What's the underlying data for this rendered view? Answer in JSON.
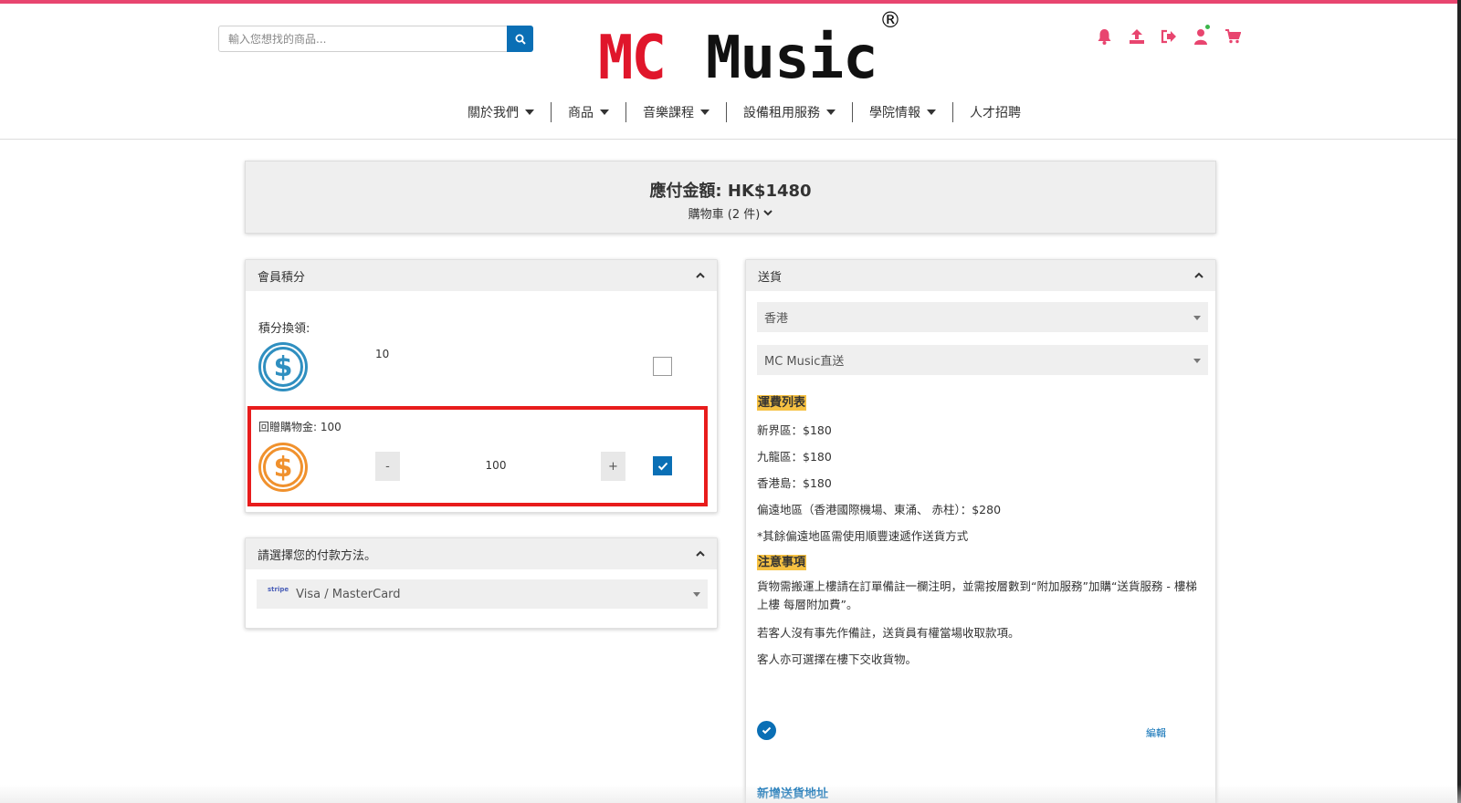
{
  "search": {
    "placeholder": "輸入您想找的商品..."
  },
  "logo": {
    "part1": "MC",
    "part2": "Music",
    "reg": "®"
  },
  "nav": [
    {
      "label": "關於我們",
      "dropdown": true
    },
    {
      "label": "商品",
      "dropdown": true
    },
    {
      "label": "音樂課程",
      "dropdown": true
    },
    {
      "label": "設備租用服務",
      "dropdown": true
    },
    {
      "label": "學院情報",
      "dropdown": true
    },
    {
      "label": "人才招聘",
      "dropdown": false
    }
  ],
  "header_icons": [
    "bell-icon",
    "upload-icon",
    "logout-icon",
    "user-icon",
    "cart-icon"
  ],
  "summary": {
    "total": "應付金額: HK$1480",
    "cart": "購物車 (2 件)"
  },
  "points": {
    "title": "會員積分",
    "redeem_label": "積分換領:",
    "redeem_value": "10",
    "redeem_checked": false,
    "bonus_label": "回贈購物金: 100",
    "minus": "-",
    "plus": "+",
    "bonus_value": "100",
    "bonus_checked": true
  },
  "payment": {
    "title": "請選擇您的付款方法。",
    "stripe": "stripe",
    "selected": "Visa / MasterCard"
  },
  "delivery": {
    "title": "送貨",
    "region": "香港",
    "method": "MC Music直送",
    "fee_heading": "運費列表",
    "fees": [
      "新界區：$180",
      "九龍區：$180",
      "香港島：$180",
      "偏遠地區（香港國際機場、東涌、 赤柱）：$280",
      "*其餘偏遠地區需使用順豐速遞作送貨方式"
    ],
    "notice_heading": "注意事項",
    "notes": [
      "貨物需搬運上樓請在訂單備註一欄注明，並需按層數到“附加服務”加購“送貨服務 - 樓梯上樓 每層附加費”。",
      "若客人沒有事先作備註，送貨員有權當場收取款項。",
      "客人亦可選擇在樓下交收貨物。"
    ],
    "edit": "編輯",
    "add_address": "新增送貨地址"
  },
  "colors": {
    "accent": "#e8456f",
    "primary": "#0a6fb5",
    "highlight": "#f6c142",
    "logo_red": "#e0162b"
  }
}
